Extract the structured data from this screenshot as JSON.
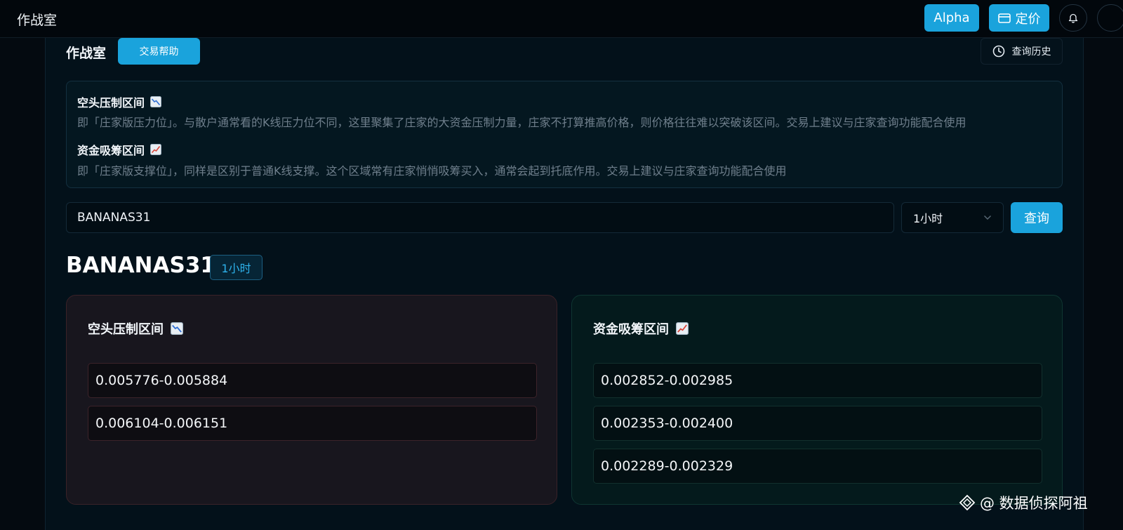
{
  "topbar": {
    "app_title": "作战室",
    "alpha_label": "Alpha",
    "pricing_label": "定价"
  },
  "panel": {
    "title": "作战室",
    "help_label": "交易帮助",
    "history_label": "查询历史"
  },
  "info": {
    "short_title": "空头压制区间",
    "short_desc": "即「庄家版压力位」。与散户通常看的K线压力位不同，这里聚集了庄家的大资金压制力量，庄家不打算推高价格，则价格往往难以突破该区间。交易上建议与庄家查询功能配合使用",
    "long_title": "资金吸筹区间",
    "long_desc": "即「庄家版支撑位」，同样是区别于普通K线支撑。这个区域常有庄家悄悄吸筹买入，通常会起到托底作用。交易上建议与庄家查询功能配合使用"
  },
  "search": {
    "value": "BANANAS31",
    "timeframe": "1小时",
    "query_label": "查询"
  },
  "result": {
    "symbol": "BANANAS31",
    "timeframe": "1小时",
    "short_card": {
      "title": "空头压制区间",
      "ranges": [
        "0.005776-0.005884",
        "0.006104-0.006151"
      ]
    },
    "long_card": {
      "title": "资金吸筹区间",
      "ranges": [
        "0.002852-0.002985",
        "0.002353-0.002400",
        "0.002289-0.002329"
      ]
    }
  },
  "watermark": {
    "text": "@ 数据侦探阿祖"
  },
  "icons": {
    "short": "chart-decreasing-icon",
    "long": "chart-increasing-icon"
  },
  "colors": {
    "accent": "#1aa3dc",
    "background": "#040a10",
    "short_card_bg": "#18161e",
    "long_card_bg": "#041a1c"
  }
}
